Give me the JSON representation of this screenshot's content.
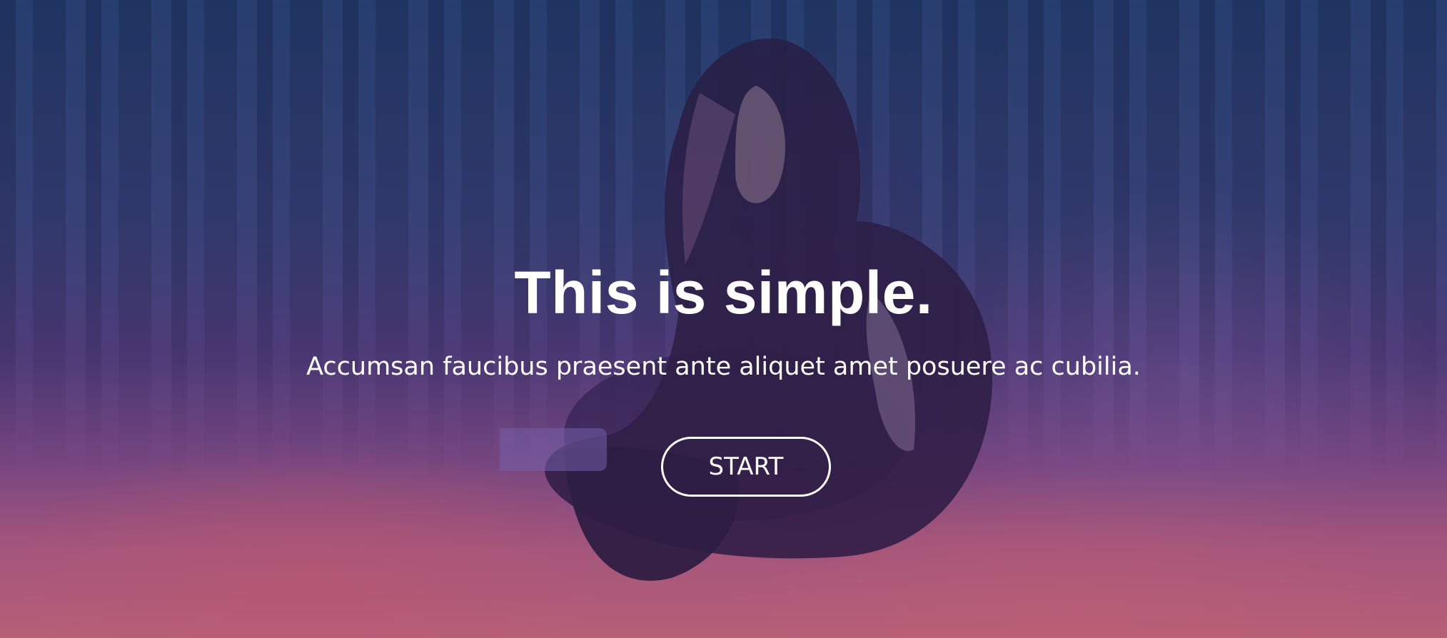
{
  "hero": {
    "title": "This is simple.",
    "subtitle": "Accumsan faucibus praesent ante aliquet amet posuere ac cubilia.",
    "cta_label": "START"
  },
  "colors": {
    "text": "#ffffff",
    "overlay_top": "#2f3f70",
    "overlay_bottom": "#c96b73"
  },
  "icons": {
    "background_image": "forest-woman-writing"
  }
}
